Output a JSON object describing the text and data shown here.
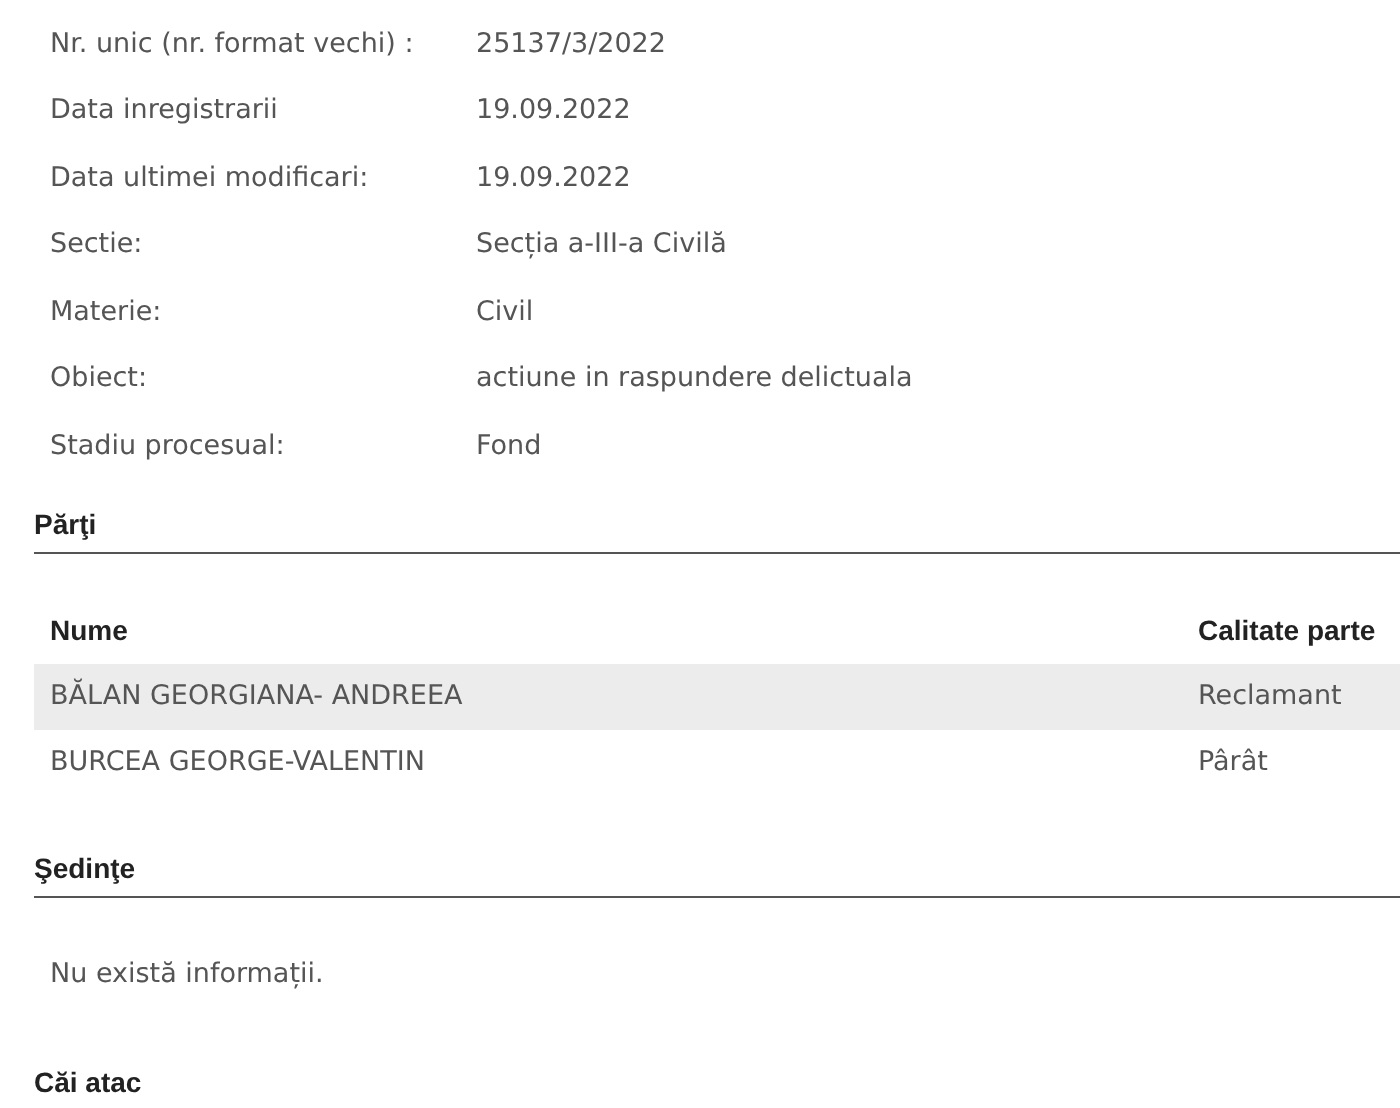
{
  "details": [
    {
      "label": "Nr. unic (nr. format vechi) :",
      "value": "25137/3/2022"
    },
    {
      "label": "Data inregistrarii",
      "value": "19.09.2022"
    },
    {
      "label": "Data ultimei modificari:",
      "value": "19.09.2022"
    },
    {
      "label": "Sectie:",
      "value": "Secția a-III-a Civilă"
    },
    {
      "label": "Materie:",
      "value": "Civil"
    },
    {
      "label": "Obiect:",
      "value": "actiune in raspundere delictuala"
    },
    {
      "label": "Stadiu procesual:",
      "value": "Fond"
    }
  ],
  "parti": {
    "heading": "Părţi",
    "columns": [
      "Nume",
      "Calitate parte"
    ],
    "rows": [
      {
        "name": "BĂLAN GEORGIANA- ANDREEA",
        "role": "Reclamant"
      },
      {
        "name": "BURCEA GEORGE-VALENTIN",
        "role": "Pârât"
      }
    ]
  },
  "sedinte": {
    "heading": "Şedinţe",
    "message": "Nu există informații."
  },
  "cai_atac": {
    "heading": "Căi atac"
  }
}
